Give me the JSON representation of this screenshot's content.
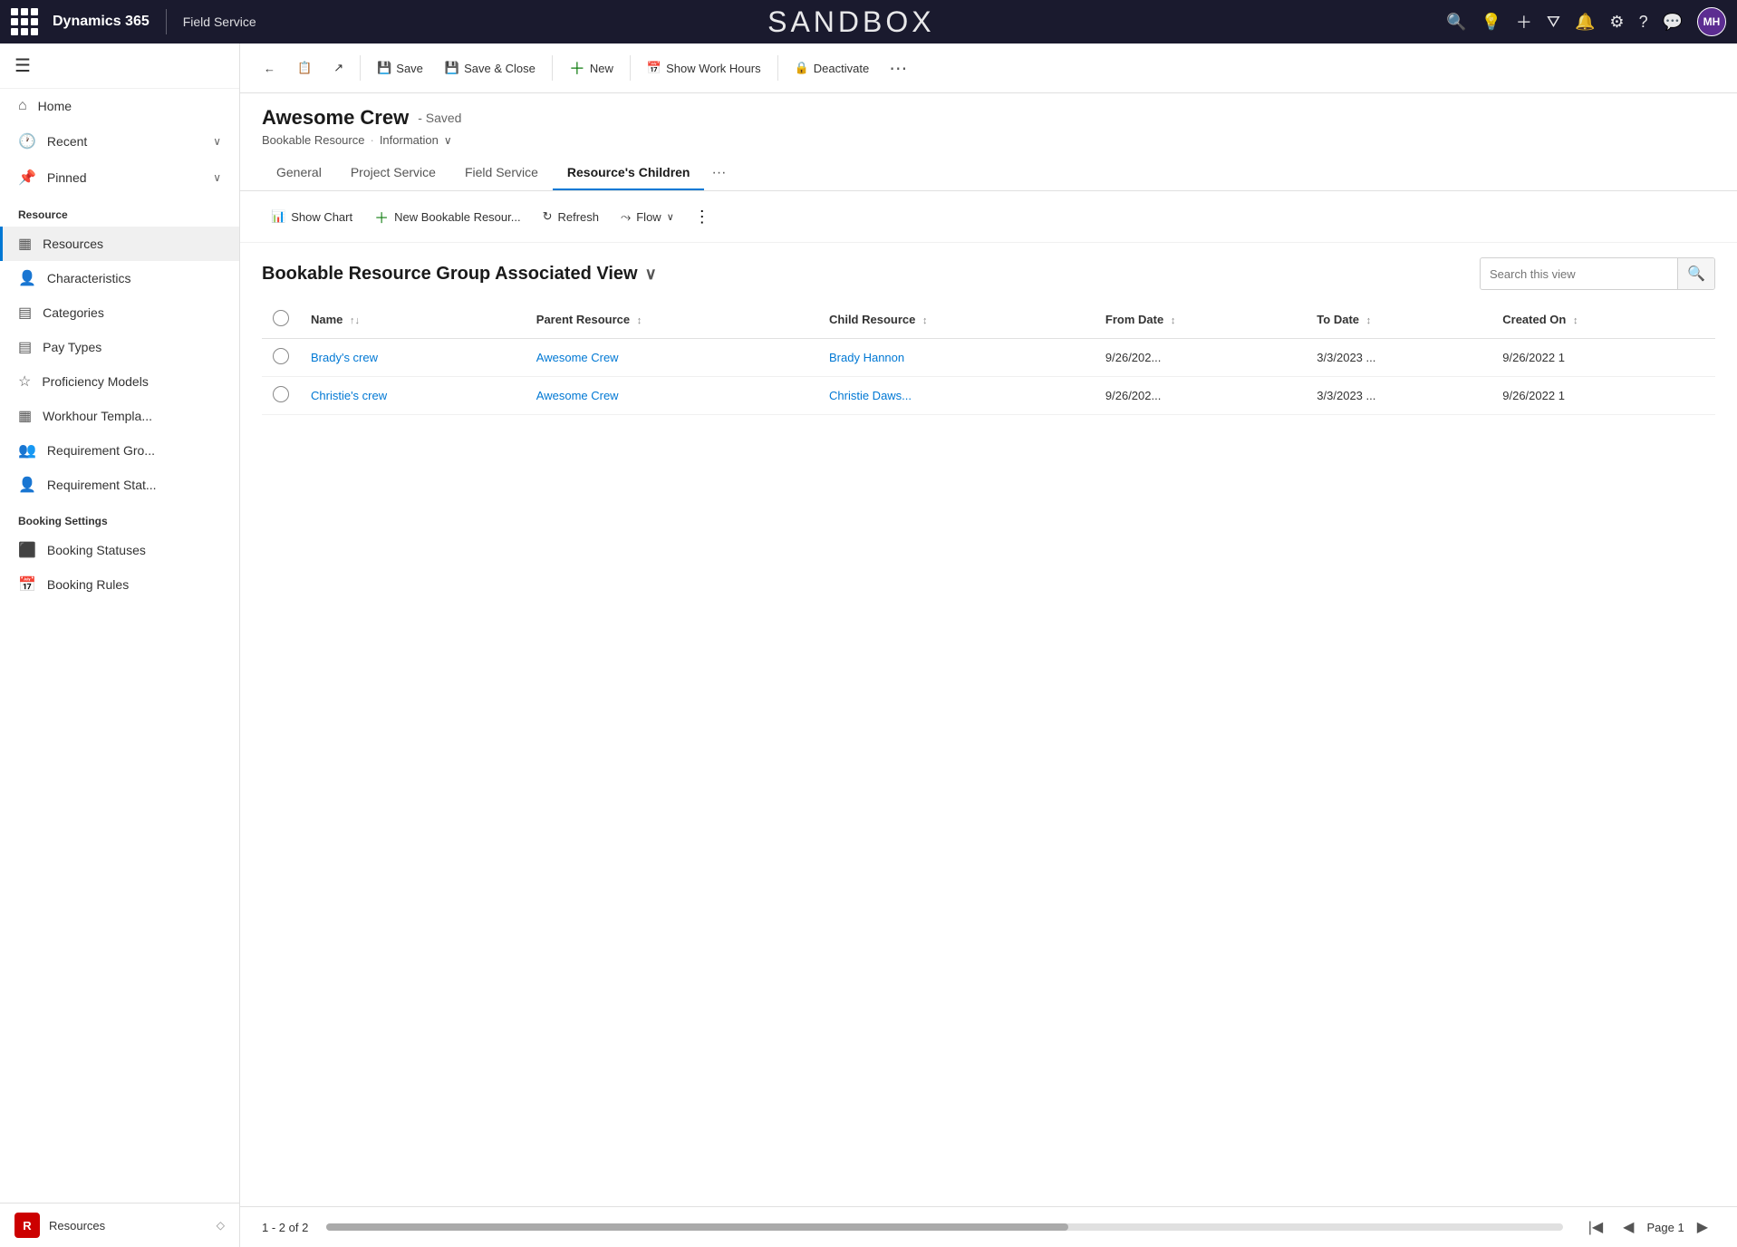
{
  "topbar": {
    "brand": "Dynamics 365",
    "module": "Field Service",
    "sandbox_label": "SANDBOX",
    "avatar_initials": "MH"
  },
  "sidebar": {
    "nav_items": [
      {
        "id": "home",
        "icon": "⌂",
        "label": "Home"
      },
      {
        "id": "recent",
        "icon": "🕐",
        "label": "Recent",
        "has_chevron": true
      },
      {
        "id": "pinned",
        "icon": "📌",
        "label": "Pinned",
        "has_chevron": true
      }
    ],
    "resource_section_label": "Resource",
    "resource_items": [
      {
        "id": "resources",
        "icon": "▦",
        "label": "Resources",
        "active": true
      },
      {
        "id": "characteristics",
        "icon": "👤",
        "label": "Characteristics"
      },
      {
        "id": "categories",
        "icon": "▤",
        "label": "Categories"
      },
      {
        "id": "pay-types",
        "icon": "▤",
        "label": "Pay Types"
      },
      {
        "id": "proficiency-models",
        "icon": "☆",
        "label": "Proficiency Models"
      },
      {
        "id": "workhour-templates",
        "icon": "▦",
        "label": "Workhour Templa..."
      },
      {
        "id": "requirement-groups",
        "icon": "👥",
        "label": "Requirement Gro..."
      },
      {
        "id": "requirement-statuses",
        "icon": "👤",
        "label": "Requirement Stat..."
      }
    ],
    "booking_section_label": "Booking Settings",
    "booking_items": [
      {
        "id": "booking-statuses",
        "icon": "⬛",
        "label": "Booking Statuses"
      },
      {
        "id": "booking-rules",
        "icon": "📅",
        "label": "Booking Rules"
      }
    ],
    "bottom_item": {
      "icon": "R",
      "label": "Resources",
      "has_chevron": true
    }
  },
  "toolbar": {
    "back_label": "←",
    "form_icon": "📋",
    "open_icon": "↗",
    "save_label": "Save",
    "save_close_label": "Save & Close",
    "new_label": "New",
    "show_work_hours_label": "Show Work Hours",
    "deactivate_label": "Deactivate",
    "more_label": "⋯"
  },
  "record": {
    "title": "Awesome Crew",
    "saved_status": "- Saved",
    "type": "Bookable Resource",
    "view_mode": "Information"
  },
  "tabs": [
    {
      "id": "general",
      "label": "General",
      "active": false
    },
    {
      "id": "project-service",
      "label": "Project Service",
      "active": false
    },
    {
      "id": "field-service",
      "label": "Field Service",
      "active": false
    },
    {
      "id": "resources-children",
      "label": "Resource's Children",
      "active": true
    }
  ],
  "sub_toolbar": {
    "show_chart_label": "Show Chart",
    "new_bookable_label": "New Bookable Resour...",
    "refresh_label": "Refresh",
    "flow_label": "Flow"
  },
  "view": {
    "title": "Bookable Resource Group Associated View",
    "search_placeholder": "Search this view"
  },
  "table": {
    "columns": [
      {
        "id": "name",
        "label": "Name",
        "sortable": true
      },
      {
        "id": "parent-resource",
        "label": "Parent Resource",
        "sortable": true
      },
      {
        "id": "child-resource",
        "label": "Child Resource",
        "sortable": true
      },
      {
        "id": "from-date",
        "label": "From Date",
        "sortable": true
      },
      {
        "id": "to-date",
        "label": "To Date",
        "sortable": true
      },
      {
        "id": "created-on",
        "label": "Created On",
        "sortable": true
      }
    ],
    "rows": [
      {
        "name": "Brady's crew",
        "parent_resource": "Awesome Crew",
        "child_resource": "Brady Hannon",
        "from_date": "9/26/202...",
        "to_date": "3/3/2023 ...",
        "created_on": "9/26/2022 1"
      },
      {
        "name": "Christie's crew",
        "parent_resource": "Awesome Crew",
        "child_resource": "Christie Daws...",
        "from_date": "9/26/202...",
        "to_date": "3/3/2023 ...",
        "created_on": "9/26/2022 1"
      }
    ]
  },
  "footer": {
    "record_count": "1 - 2 of 2",
    "page_label": "Page 1"
  }
}
